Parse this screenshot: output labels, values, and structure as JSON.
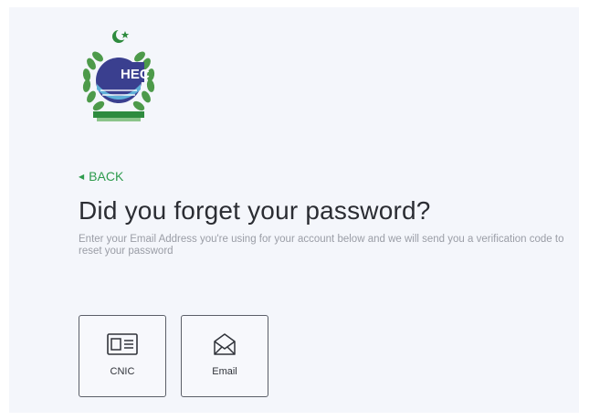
{
  "logo": {
    "icon": "hec-emblem-icon",
    "text": "HEC"
  },
  "back": {
    "label": "BACK",
    "icon": "caret-left-icon"
  },
  "header": {
    "title": "Did you forget your password?",
    "subtitle": "Enter your Email Address you're using for your account below and we will send you a verification code to reset your password"
  },
  "options": [
    {
      "label": "CNIC",
      "icon": "id-card-icon"
    },
    {
      "label": "Email",
      "icon": "envelope-icon"
    }
  ],
  "colors": {
    "accent": "#2e9b4e",
    "background": "#f4f6fb",
    "title": "#2b2d33",
    "subtitle": "#9a9da6",
    "card_border": "#5b5f68"
  }
}
